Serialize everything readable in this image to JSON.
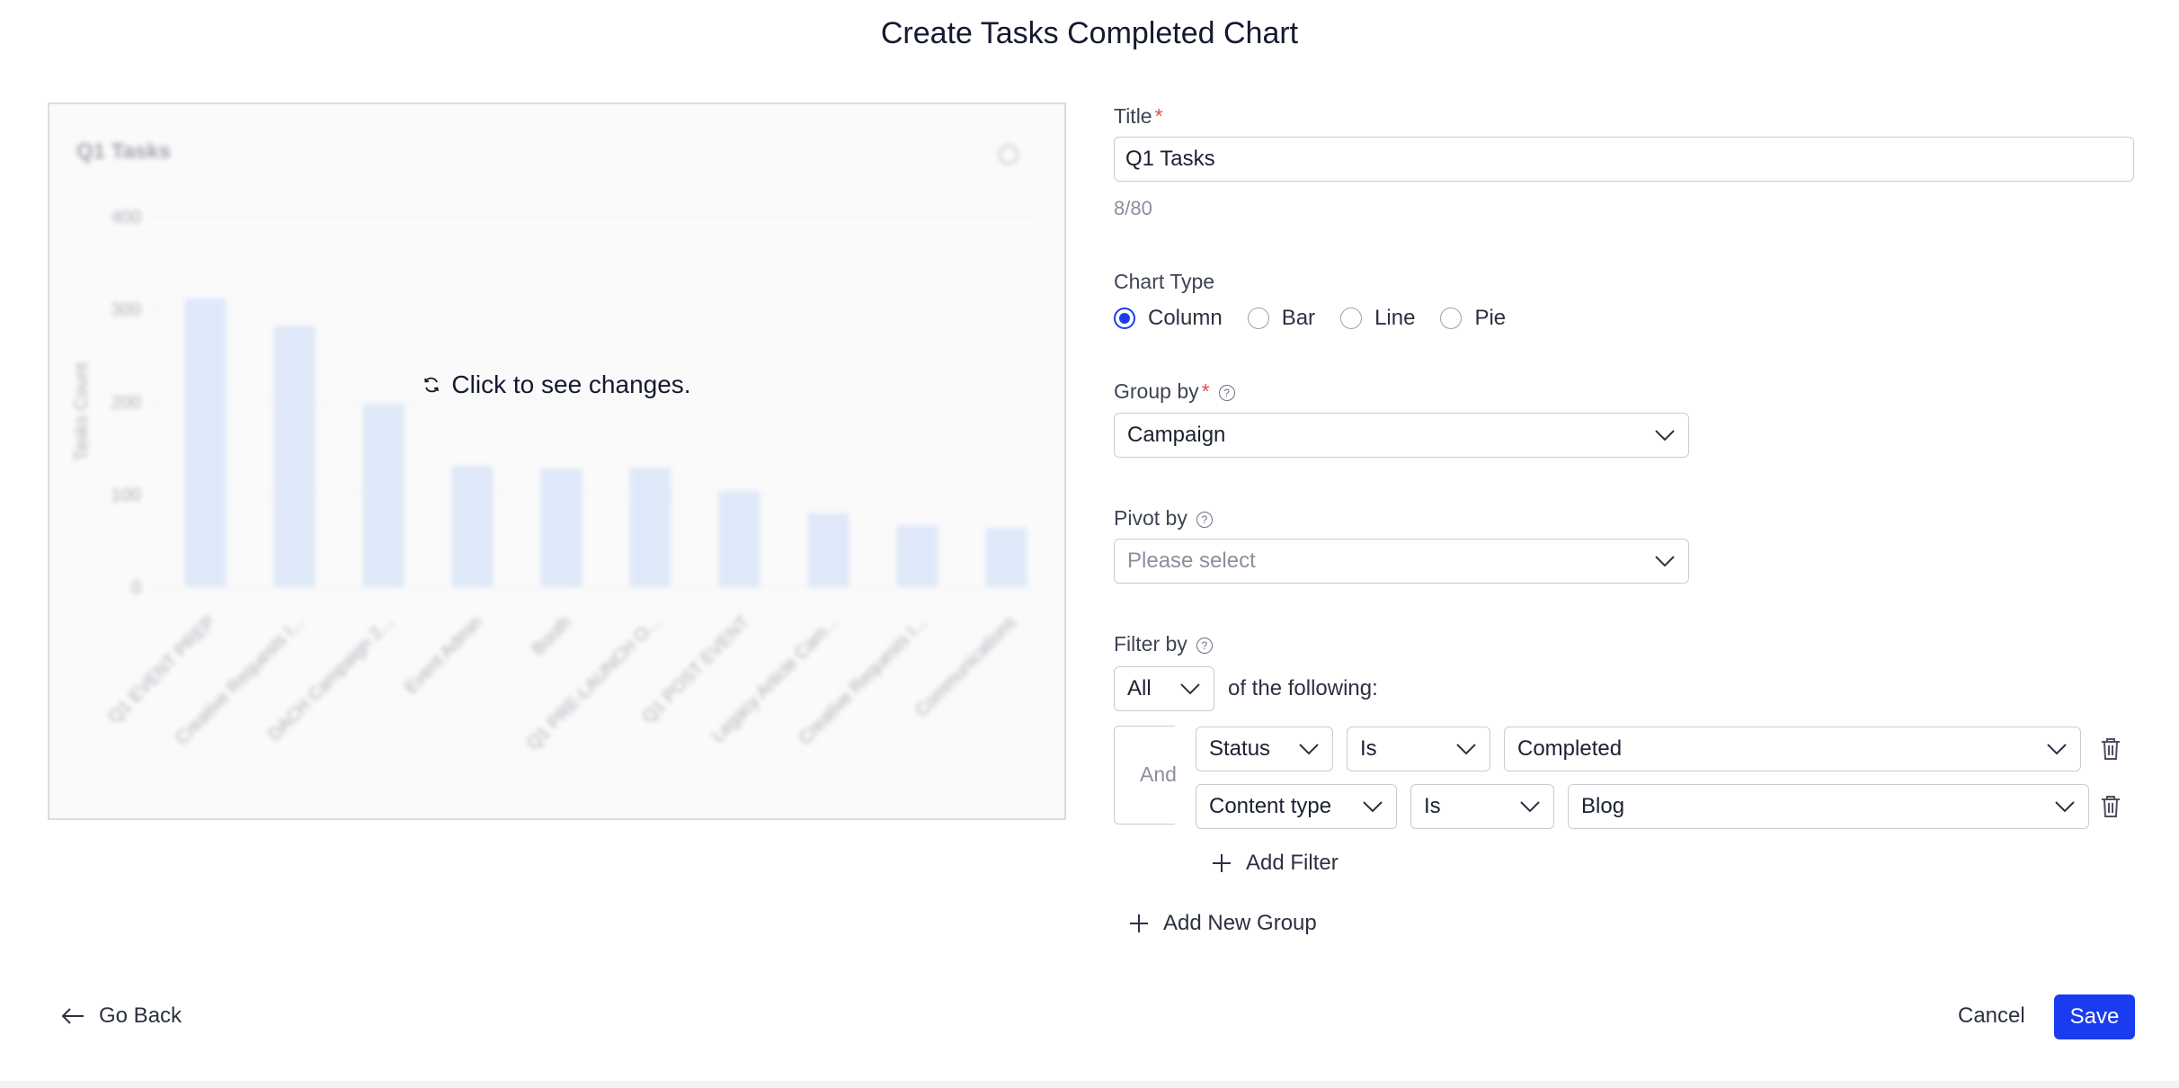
{
  "page": {
    "title": "Create Tasks Completed Chart"
  },
  "preview": {
    "overlay_text": "Click to see changes.",
    "chart_data": {
      "type": "bar",
      "title": "Q1 Tasks",
      "ylabel": "Tasks Count",
      "xlabel": "",
      "ylim": [
        0,
        400
      ],
      "yticks": [
        "400",
        "300",
        "200",
        "100",
        "0"
      ],
      "categories": [
        "Q1 EVENT PREP",
        "Creative Requests I...",
        "DACH Campaign 2...",
        "Event Admin",
        "Booth",
        "Q1 PRE-LAUNCH O...",
        "Q1 POST EVENT",
        "Legacy Article Cam...",
        "Creative Requests I...",
        "Communications"
      ],
      "values": [
        312,
        282,
        198,
        131,
        128,
        129,
        104,
        80,
        67,
        64
      ],
      "bar_color": "#c9daf8",
      "grid": true,
      "legend": "none"
    }
  },
  "form": {
    "title_label": "Title",
    "title_value": "Q1 Tasks",
    "title_counter": "8/80",
    "chart_type_label": "Chart Type",
    "chart_types": [
      "Column",
      "Bar",
      "Line",
      "Pie"
    ],
    "chart_type_selected": "Column",
    "group_by_label": "Group by",
    "group_by_value": "Campaign",
    "pivot_by_label": "Pivot by",
    "pivot_by_placeholder": "Please select",
    "filter_by_label": "Filter by",
    "filter_match_value": "All",
    "filter_match_suffix": "of the following:",
    "filter_group_operator": "And",
    "filters": [
      {
        "field": "Status",
        "operator": "Is",
        "value": "Completed"
      },
      {
        "field": "Content type",
        "operator": "Is",
        "value": "Blog"
      }
    ],
    "add_filter_label": "Add Filter",
    "add_group_label": "Add New Group"
  },
  "footer": {
    "go_back_label": "Go Back",
    "cancel_label": "Cancel",
    "save_label": "Save"
  },
  "colors": {
    "accent": "#1a3cf0",
    "required": "#e5484d"
  }
}
